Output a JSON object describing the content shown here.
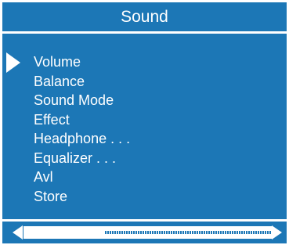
{
  "title": "Sound",
  "colors": {
    "panel": "#1c77b6",
    "text": "#ffffff",
    "background": "#ffffff"
  },
  "menu": {
    "selected_index": 0,
    "items": [
      {
        "label": "Volume"
      },
      {
        "label": "Balance"
      },
      {
        "label": "Sound Mode"
      },
      {
        "label": "Effect"
      },
      {
        "label": "Headphone . . ."
      },
      {
        "label": "Equalizer . . ."
      },
      {
        "label": "Avl"
      },
      {
        "label": "Store"
      }
    ]
  },
  "slider": {
    "fraction": 0.32,
    "left_icon": "arrow-left-icon",
    "right_icon": "arrow-right-icon"
  }
}
